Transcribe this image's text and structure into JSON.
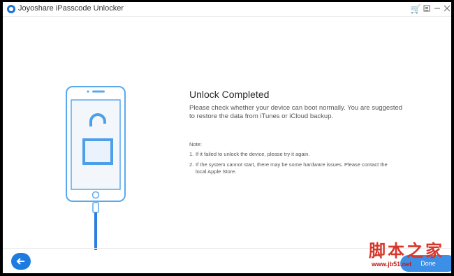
{
  "window": {
    "title": "Joyoshare iPasscode Unlocker"
  },
  "titlebar_icons": [
    "cart-icon",
    "menu-icon",
    "minimize-icon",
    "close-icon"
  ],
  "main": {
    "heading": "Unlock Completed",
    "description": "Please check whether your device can boot normally. You are suggested to restore the data from iTunes or iCloud backup.",
    "note_label": "Note:",
    "notes": [
      {
        "num": "1.",
        "text": "If it failed to unlock the device, please try it again."
      },
      {
        "num": "2.",
        "text": "If the system cannot start, there may be some hardware issues. Please contact the local Apple Store."
      }
    ]
  },
  "footer": {
    "done_label": "Done"
  },
  "watermark": {
    "chinese": "脚本之家",
    "url": "www.jb51.net"
  },
  "colors": {
    "accent": "#1e7be0",
    "phone_outline": "#5aa9ef",
    "lock_outline": "#4d9fe8",
    "watermark": "#d9362b"
  }
}
